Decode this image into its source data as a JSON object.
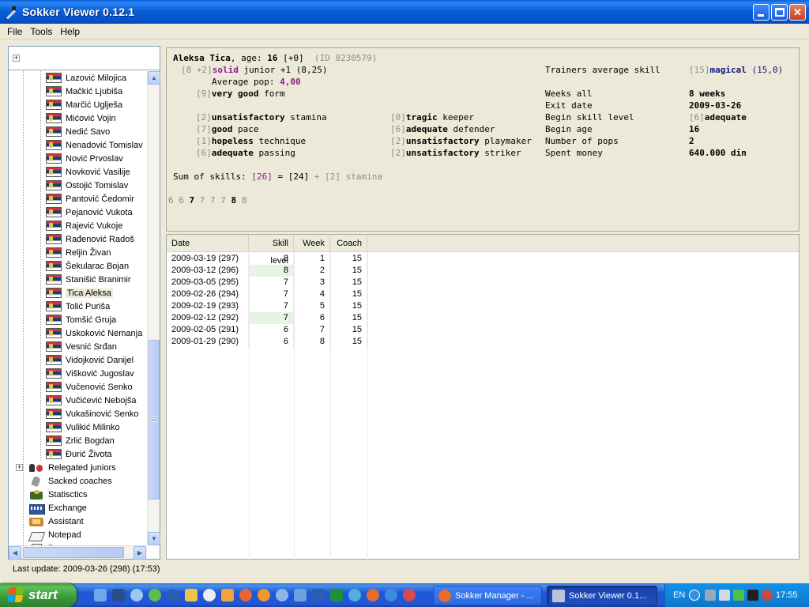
{
  "window": {
    "title": "Sokker Viewer 0.12.1"
  },
  "menu": [
    "File",
    "Tools",
    "Help"
  ],
  "tree": {
    "players": [
      "Lazović Milojica",
      "Mačkić Ljubiša",
      "Marčić Uglješa",
      "Mićović Vojin",
      "Nedić Savo",
      "Nenadović Tomislav",
      "Nović Prvoslav",
      "Novković Vasilije",
      "Ostojić Tomislav",
      "Pantović Čedomir",
      "Pejanović Vukota",
      "Rajević Vukoje",
      "Rađenović Radoš",
      "Reljin Živan",
      "Šekularac Bojan",
      "Stanišić Branimir",
      "Tica Aleksa",
      "Tolić Puriša",
      "Tomšić Gruja",
      "Uskoković Nemanja",
      "Vesnić Srđan",
      "Vidojković Danijel",
      "Višković Jugoslav",
      "Vučenović Senko",
      "Vučićević Nebojša",
      "Vukašinović Senko",
      "Vulikić Milinko",
      "Zrlić Bogdan",
      "Đurić Života"
    ],
    "selected_player": "Tica Aleksa",
    "sections": [
      {
        "label": "Relegated juniors",
        "icon": "relegated-juniors-icon"
      },
      {
        "label": "Sacked coaches",
        "icon": "sacked-coaches-icon"
      },
      {
        "label": "Statisctics",
        "icon": "statistics-icon"
      },
      {
        "label": "Exchange",
        "icon": "exchange-icon"
      },
      {
        "label": "Assistant",
        "icon": "assistant-icon"
      },
      {
        "label": "Notepad",
        "icon": "notepad-icon"
      },
      {
        "label": "Ba...",
        "icon": "document-icon"
      }
    ]
  },
  "player": {
    "name": "Aleksa Tica",
    "age_label": ", age: ",
    "age": "16",
    "age_plus": "[+0]",
    "id": "(ID 8230579)",
    "level_prefix": "[8 +2]",
    "level_word": "solid",
    "level_rest": " junior +1 (8,25)",
    "avg_pop_label": "Average pop: ",
    "avg_pop": "4,00",
    "form_bracket": "[9]",
    "form_word": "very good",
    "form_rest": " form",
    "skills": [
      {
        "bracket": "[2]",
        "word": "unsatisfactory",
        "name": " stamina"
      },
      {
        "bracket": "[7]",
        "word": "good",
        "name": " pace"
      },
      {
        "bracket": "[1]",
        "word": "hopeless",
        "name": " technique"
      },
      {
        "bracket": "[6]",
        "word": "adequate",
        "name": " passing"
      },
      {
        "bracket": "[0]",
        "word": "tragic",
        "name": " keeper"
      },
      {
        "bracket": "[6]",
        "word": "adequate",
        "name": " defender"
      },
      {
        "bracket": "[2]",
        "word": "unsatisfactory",
        "name": " playmaker"
      },
      {
        "bracket": "[2]",
        "word": "unsatisfactory",
        "name": " striker"
      }
    ],
    "info": [
      {
        "label": "Trainers average skill",
        "bracket": "[15]",
        "value": "magical",
        "extra": " (15,0)"
      },
      {
        "label": "Weeks all",
        "bracket": "",
        "value": "8 weeks",
        "extra": ""
      },
      {
        "label": "Exit date",
        "bracket": "",
        "value": "2009-03-26",
        "extra": ""
      },
      {
        "label": "Begin skill level",
        "bracket": "[6]",
        "value": "adequate",
        "extra": ""
      },
      {
        "label": "Begin age",
        "bracket": "",
        "value": "16",
        "extra": ""
      },
      {
        "label": "Number of pops",
        "bracket": "",
        "value": "2",
        "extra": ""
      },
      {
        "label": "Spent money",
        "bracket": "",
        "value": "640.000 din",
        "extra": ""
      }
    ],
    "sum_label": "Sum of skills: ",
    "sum_total": "[26]",
    "sum_eq": " = ",
    "sum_base": "[24]",
    "sum_plus": " + ",
    "sum_stamina": "[2] stamina",
    "history": [
      {
        "v": "6",
        "bold": false
      },
      {
        "v": "6",
        "bold": false
      },
      {
        "v": "7",
        "bold": true
      },
      {
        "v": "7",
        "bold": false
      },
      {
        "v": "7",
        "bold": false
      },
      {
        "v": "7",
        "bold": false
      },
      {
        "v": "8",
        "bold": true
      },
      {
        "v": "8",
        "bold": false
      }
    ]
  },
  "table": {
    "headers": [
      "Date",
      "Skill level",
      "Week",
      "Coach"
    ],
    "rows": [
      {
        "date": "2009-03-19 (297)",
        "skill": "8",
        "week": "1",
        "coach": "15",
        "highlight": false
      },
      {
        "date": "2009-03-12 (296)",
        "skill": "8",
        "week": "2",
        "coach": "15",
        "highlight": true
      },
      {
        "date": "2009-03-05 (295)",
        "skill": "7",
        "week": "3",
        "coach": "15",
        "highlight": false
      },
      {
        "date": "2009-02-26 (294)",
        "skill": "7",
        "week": "4",
        "coach": "15",
        "highlight": false
      },
      {
        "date": "2009-02-19 (293)",
        "skill": "7",
        "week": "5",
        "coach": "15",
        "highlight": false
      },
      {
        "date": "2009-02-12 (292)",
        "skill": "7",
        "week": "6",
        "coach": "15",
        "highlight": true
      },
      {
        "date": "2009-02-05 (291)",
        "skill": "6",
        "week": "7",
        "coach": "15",
        "highlight": false
      },
      {
        "date": "2009-01-29 (290)",
        "skill": "6",
        "week": "8",
        "coach": "15",
        "highlight": false
      }
    ]
  },
  "status": {
    "last_update": "Last update: 2009-03-26 (298) (17:53)"
  },
  "taskbar": {
    "start": "start",
    "tasks": [
      {
        "label": "Sokker Manager - ...",
        "active": false
      },
      {
        "label": "Sokker Viewer 0.1...",
        "active": true
      }
    ],
    "lang": "EN",
    "clock": "17:55"
  }
}
